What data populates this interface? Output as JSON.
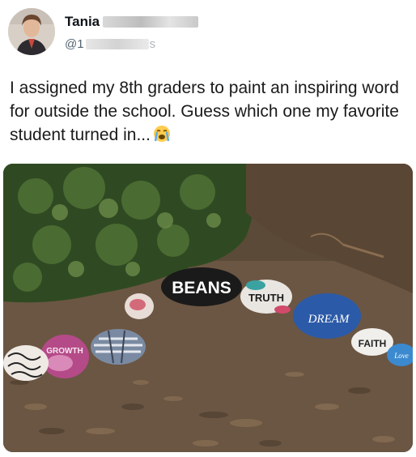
{
  "tweet": {
    "author_name": "Tania",
    "handle_prefix": "@",
    "handle_visible": "1",
    "handle_tail": "s",
    "text": "I assigned my 8th graders to paint an inspiring word for outside the school. Guess which one my favorite student turned in...",
    "emoji_icon": "loudly-crying-face-icon"
  },
  "photo": {
    "rocks": {
      "beans": "BEANS",
      "truth": "TRUTH",
      "dream": "DREAM",
      "faith": "FAITH",
      "growth": "GROWTH",
      "love": "Love"
    }
  },
  "colors": {
    "text": "#0f1419",
    "muted": "#536471",
    "background": "#ffffff"
  }
}
